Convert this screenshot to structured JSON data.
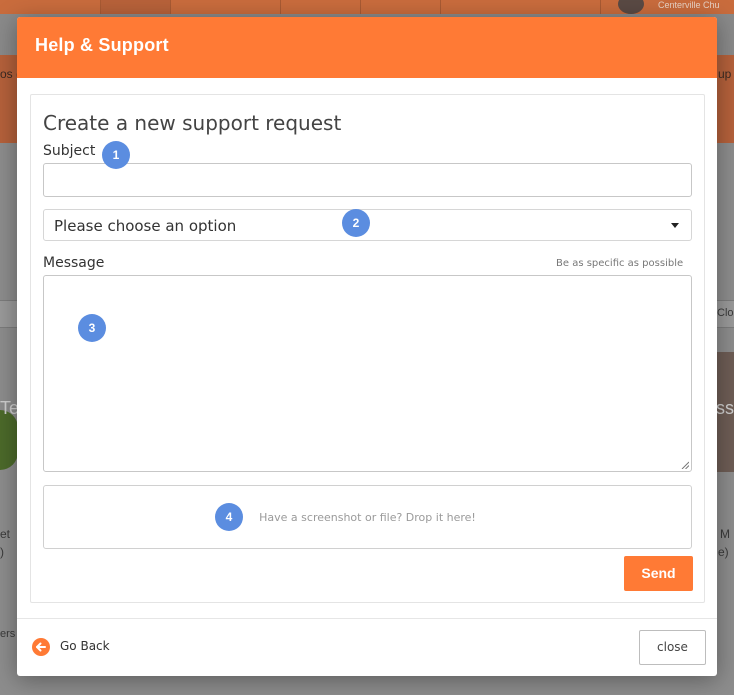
{
  "background": {
    "user_name": "Centerville Chu",
    "tab_fragment_left": "os (",
    "tab_fragment_right": "up",
    "close_fragment": "Clo",
    "card_text_left_1": "et",
    "card_text_left_2": ")",
    "card_text_right_1": "M",
    "card_text_right_2": "e)",
    "text_left_3": "ers",
    "te_fragment": "Te",
    "ss_fragment": "ss"
  },
  "modal": {
    "title": "Help & Support",
    "form": {
      "heading": "Create a new support request",
      "subject_label": "Subject",
      "subject_value": "",
      "category_select_value": "Please choose an option",
      "message_label": "Message",
      "message_hint": "Be as specific as possible",
      "message_value": "",
      "dropzone_text": "Have a screenshot or file? Drop it here!",
      "send_label": "Send"
    },
    "badges": [
      "1",
      "2",
      "3",
      "4"
    ],
    "footer": {
      "go_back_label": "Go Back",
      "close_label": "close"
    }
  },
  "colors": {
    "accent": "#ff7a35",
    "badge": "#5b8de0"
  }
}
